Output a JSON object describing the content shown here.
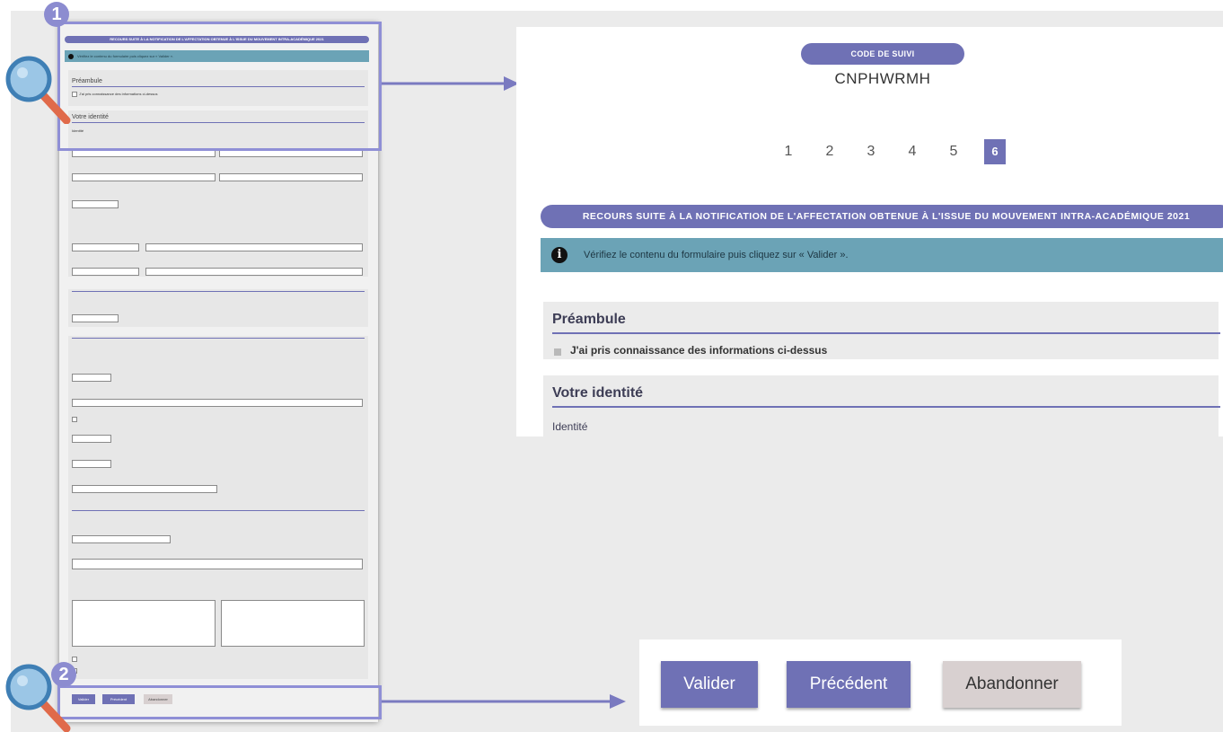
{
  "tracking": {
    "label": "CODE DE SUIVI",
    "code": "CNPHWRMH"
  },
  "pagination": {
    "pages": [
      "1",
      "2",
      "3",
      "4",
      "5"
    ],
    "active": "6"
  },
  "form": {
    "banner": "RECOURS SUITE À LA NOTIFICATION DE L'AFFECTATION OBTENUE À L'ISSUE DU MOUVEMENT INTRA-ACADÉMIQUE 2021",
    "info": "Vérifiez le contenu du formulaire puis cliquez sur « Valider ».",
    "preambule": {
      "heading": "Préambule",
      "checkbox_label": "J'ai pris connaissance des informations ci-dessus"
    },
    "identite": {
      "heading": "Votre identité",
      "subheading": "Identité"
    }
  },
  "buttons": {
    "valider": "Valider",
    "precedent": "Précédent",
    "abandonner": "Abandonner"
  },
  "annotations": {
    "badge_1": "1",
    "badge_2": "2"
  },
  "colors": {
    "primary": "#6f71b5",
    "info_bg": "#6ba3b6",
    "abandon_bg": "#d8d0d0",
    "highlight": "#8f8fd6"
  }
}
